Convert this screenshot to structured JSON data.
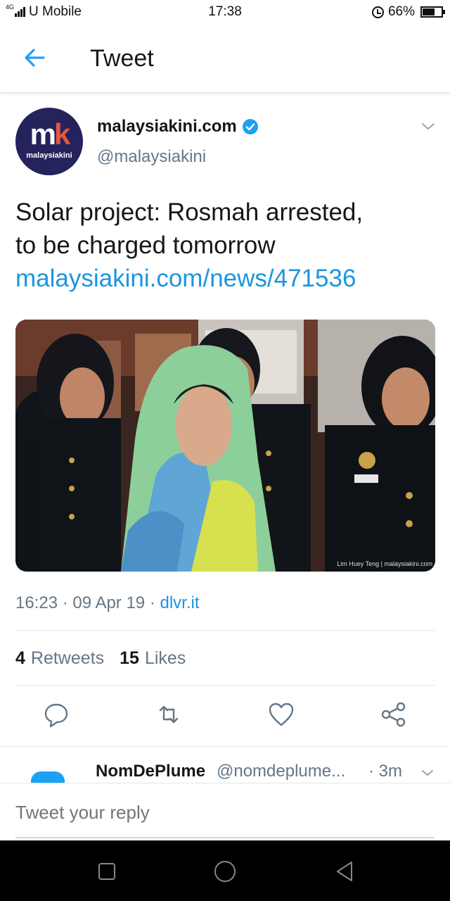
{
  "status_bar": {
    "network": "4G",
    "carrier": "U Mobile",
    "time": "17:38",
    "battery": "66%"
  },
  "header": {
    "title": "Tweet",
    "back_icon": "arrow-left-icon"
  },
  "tweet": {
    "avatar_mark_a": "m",
    "avatar_mark_b": "k",
    "avatar_brand": "malaysiakini",
    "display_name": "malaysiakini.com",
    "handle": "@malaysiakini",
    "text_line1": "Solar project: Rosmah arrested,",
    "text_line2": "to be charged tomorrow",
    "link": "malaysiakini.com/news/471536",
    "photo_credit": "Lim Huey Teng | malaysiakini.com",
    "time": "16:23",
    "date": "09 Apr 19",
    "source": "dlvr.it",
    "retweets_count": "4",
    "retweets_label": "Retweets",
    "likes_count": "15",
    "likes_label": "Likes"
  },
  "reply_preview": {
    "name": "NomDePlume",
    "handle": "@nomdeplume...",
    "time": "· 3m"
  },
  "reply_box": {
    "placeholder": "Tweet your reply"
  },
  "colors": {
    "link": "#1b95e0",
    "secondary_text": "#657786",
    "avatar_bg": "#25235c"
  }
}
